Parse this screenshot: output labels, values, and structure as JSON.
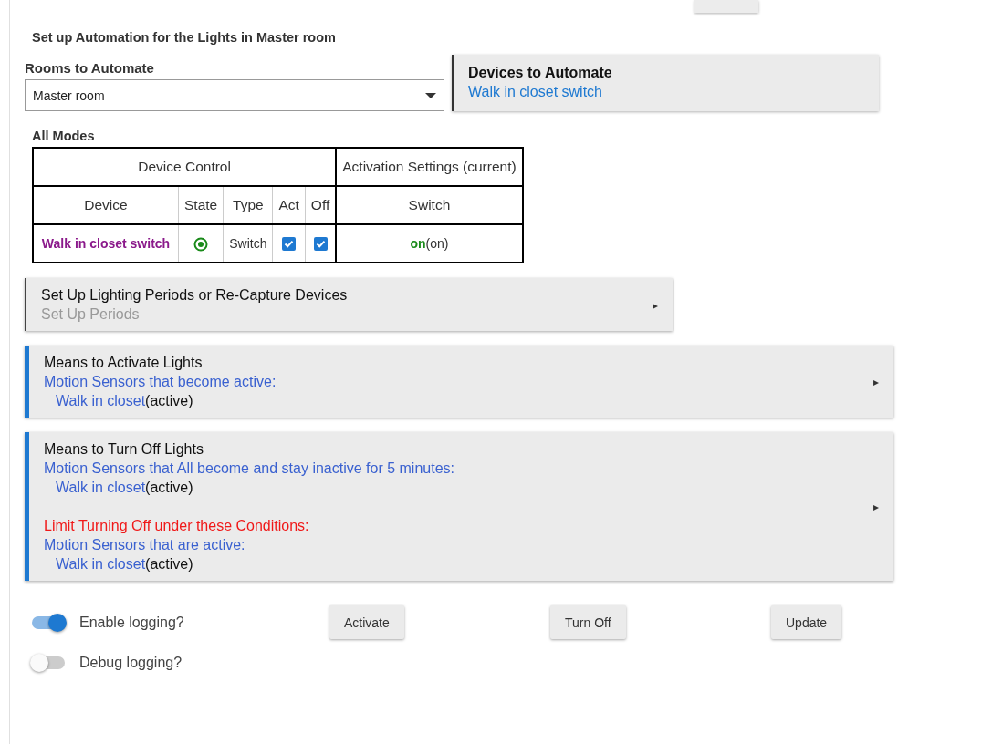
{
  "title": "Set up Automation for the Lights in Master room",
  "rooms": {
    "label": "Rooms to Automate",
    "value": "Master room"
  },
  "devices_card": {
    "title": "Devices to Automate",
    "value": "Walk in closet switch"
  },
  "modes_label": "All Modes",
  "table": {
    "group_headers": [
      "Device Control",
      "Activation Settings (current)"
    ],
    "columns": [
      "Device",
      "State",
      "Type",
      "Act",
      "Off",
      "Switch"
    ],
    "rows": [
      {
        "device": "Walk in closet switch",
        "state_on": true,
        "type": "Switch",
        "act": true,
        "off": true,
        "setting": "on",
        "setting_current": "(on)"
      }
    ]
  },
  "sections": [
    {
      "kind": "link",
      "title": "Set Up Lighting Periods or Re-Capture Devices",
      "arrow": "▸",
      "lines": [
        {
          "kind": "muted",
          "text": "Set Up Periods"
        }
      ]
    },
    {
      "kind": "config",
      "title": "Means to Activate Lights",
      "arrow": "▸",
      "lines": [
        {
          "kind": "header",
          "text": "Motion Sensors that become active:"
        },
        {
          "kind": "device",
          "text": "Walk in closet",
          "suffix": "(active)"
        }
      ]
    },
    {
      "kind": "config",
      "title": "Means to Turn Off Lights",
      "arrow": "▸",
      "lines": [
        {
          "kind": "header",
          "text": "Motion Sensors that All become and stay inactive for 5 minutes:"
        },
        {
          "kind": "device",
          "text": "Walk in closet",
          "suffix": "(active)"
        },
        {
          "kind": "warning",
          "text": "Limit Turning Off under these Conditions:"
        },
        {
          "kind": "header",
          "text": "Motion Sensors that are active:"
        },
        {
          "kind": "device",
          "text": "Walk in closet",
          "suffix": "(active)"
        }
      ]
    }
  ],
  "toggles": [
    {
      "label": "Enable logging?",
      "on": true
    },
    {
      "label": "Debug logging?",
      "on": false
    }
  ],
  "buttons": [
    "Activate",
    "Turn Off",
    "Update"
  ]
}
